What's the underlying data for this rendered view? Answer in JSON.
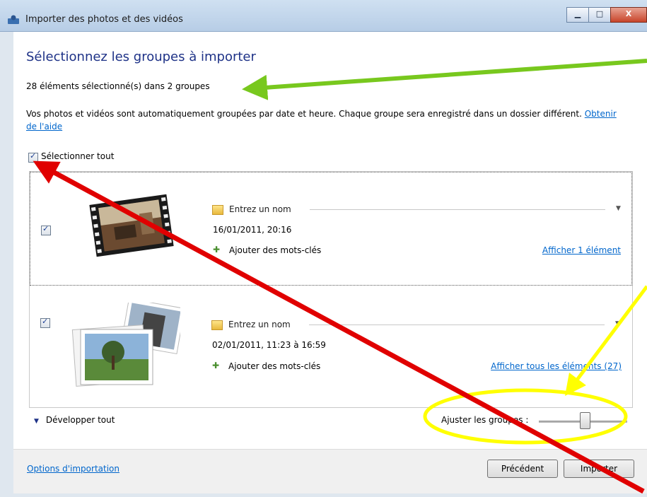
{
  "window": {
    "title": "Importer des photos et des vidéos",
    "buttons": {
      "minimize": "▁",
      "maximize": "□",
      "close": "X"
    }
  },
  "main": {
    "heading": "Sélectionnez les groupes à importer",
    "summary": "28 éléments sélectionné(s) dans 2 groupes",
    "description": "Vos photos et vidéos sont automatiquement groupées par date et heure. Chaque groupe sera enregistré dans un dossier différent.",
    "help_link": "Obtenir de l'aide",
    "select_all": {
      "label": "Sélectionner tout",
      "checked": true
    }
  },
  "groups": [
    {
      "checked": true,
      "name_placeholder": "Entrez un nom",
      "date": "16/01/2011, 20:16",
      "tags_label": "Ajouter des mots-clés",
      "show_link": "Afficher 1 élément",
      "thumbnail": "video-film-strip"
    },
    {
      "checked": true,
      "name_placeholder": "Entrez un nom",
      "date": "02/01/2011, 11:23 à 16:59",
      "tags_label": "Ajouter des mots-clés",
      "show_link": "Afficher tous les éléments (27)",
      "thumbnail": "photo-stack"
    }
  ],
  "bottom": {
    "expand_all": "Développer tout",
    "adjust_groups": "Ajuster les groupes :",
    "adjust_level": 0.55
  },
  "footer": {
    "options_link": "Options d'importation",
    "prev_button": "Précédent",
    "import_button": "Importer"
  },
  "colors": {
    "heading": "#1e3287",
    "link": "#0066cc",
    "arrow_green": "#78c81e",
    "arrow_red": "#e00000",
    "highlight_yellow": "#ffff00"
  }
}
